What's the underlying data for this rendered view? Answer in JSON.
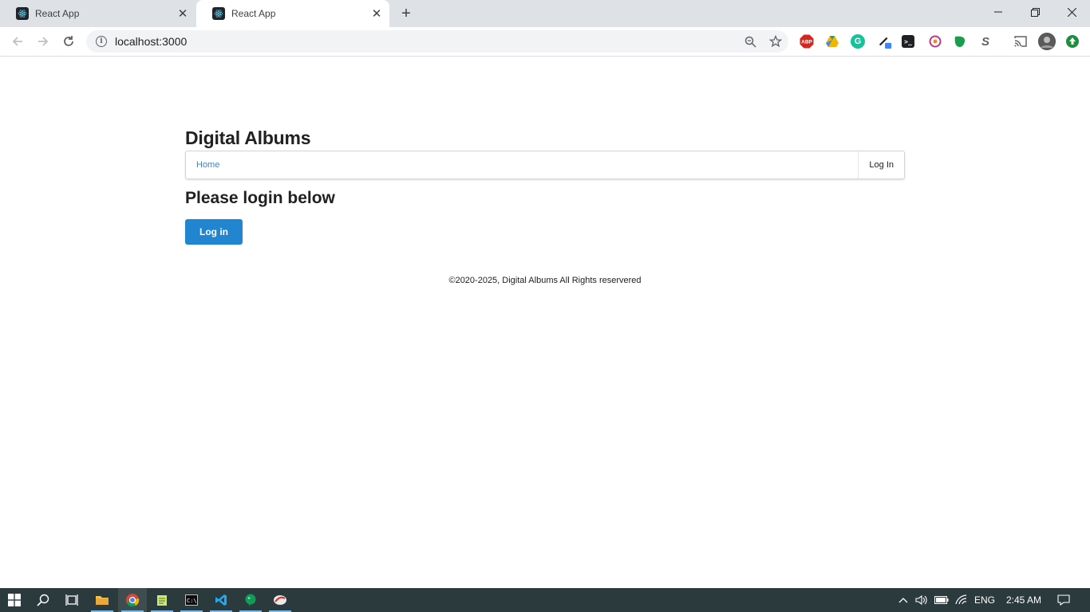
{
  "browser": {
    "tabs": [
      {
        "title": "React App",
        "active": false
      },
      {
        "title": "React App",
        "active": true
      }
    ],
    "new_tab_symbol": "+",
    "url": "localhost:3000",
    "extensions": [
      {
        "name": "adblock-plus-icon",
        "label": "ABP",
        "color": "#d9261c"
      },
      {
        "name": "google-drive-icon",
        "label": "",
        "color": "#f6b400"
      },
      {
        "name": "grammarly-icon",
        "label": "G",
        "color": "#15c39a"
      },
      {
        "name": "color-picker-icon",
        "label": "",
        "color": "#3c4043"
      },
      {
        "name": "terminal-icon",
        "label": ">_",
        "color": "#202124"
      },
      {
        "name": "camera-icon",
        "label": "",
        "color": "#c13584"
      },
      {
        "name": "leaf-icon",
        "label": "",
        "color": "#1a9e4b"
      },
      {
        "name": "s-extension-icon",
        "label": "S",
        "color": "#5f6368"
      }
    ],
    "update_color": "#1e8e3e"
  },
  "site": {
    "title": "Digital Albums",
    "menu": {
      "home": "Home",
      "login": "Log In"
    },
    "heading": "Please login below",
    "login_button": "Log in",
    "footer": "©2020-2025, Digital Albums All Rights reservered",
    "accent_color": "#2185d0",
    "link_color": "#4183c4"
  },
  "taskbar": {
    "language": "ENG",
    "time": "2:45 AM"
  }
}
